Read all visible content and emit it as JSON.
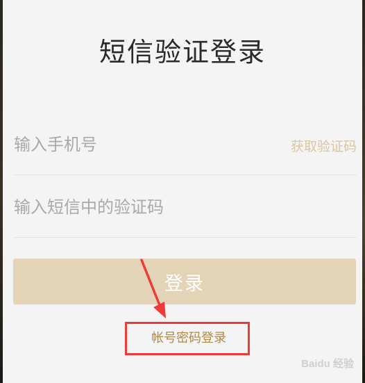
{
  "title": "短信验证登录",
  "phone_field": {
    "placeholder": "输入手机号"
  },
  "get_code_label": "获取验证码",
  "code_field": {
    "placeholder": "输入短信中的验证码"
  },
  "login_button": "登录",
  "password_login_link": "帐号密码登录",
  "watermark": "Baidu 经验",
  "colors": {
    "accent": "#e3d3b7",
    "link": "#b08947",
    "annotation": "#f03a3a",
    "background": "#f4f4f4"
  }
}
